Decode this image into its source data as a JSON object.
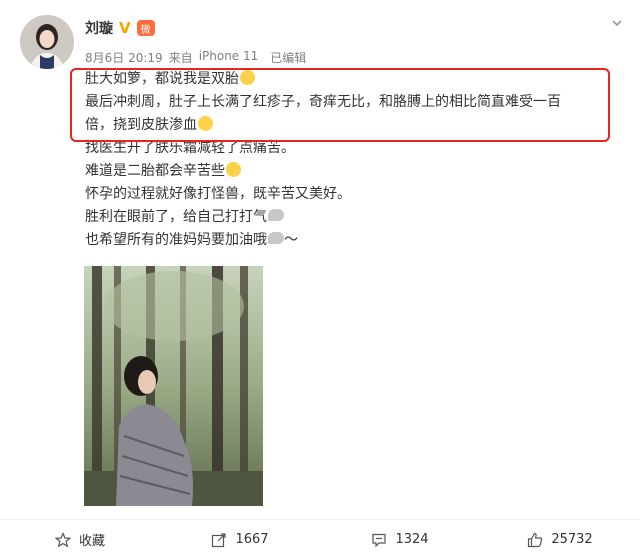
{
  "post": {
    "author": "刘璇",
    "verified_mark": "V",
    "level_badge": "微",
    "timestamp": "8月6日 20:19",
    "source_prefix": "来自",
    "device": "iPhone 11",
    "edited": "已编辑",
    "lines": [
      "肚大如箩，都说我是双胎",
      "最后冲刺周，肚子上长满了红疹子，奇痒无比，和胳膊上的相比简直难受一百",
      "倍，挠到皮肤渗血",
      "找医生开了肤乐霜减轻了点痛苦。",
      "难道是二胎都会辛苦些",
      "怀孕的过程就好像打怪兽，既辛苦又美好。",
      "胜利在眼前了，给自己打打气",
      "也希望所有的准妈妈要加油哦",
      "～"
    ]
  },
  "footer": {
    "favorite_label": "收藏",
    "repost_count": "1667",
    "comment_count": "1324",
    "like_count": "25732"
  },
  "colors": {
    "highlight_border": "#e8241c",
    "verified": "#f7a600",
    "meta_text": "#808080"
  },
  "icons": {
    "favorite": "star-outline-icon",
    "repost": "share-arrow-icon",
    "comment": "comment-icon",
    "like": "thumbs-up-icon",
    "menu": "chevron-down-icon"
  }
}
